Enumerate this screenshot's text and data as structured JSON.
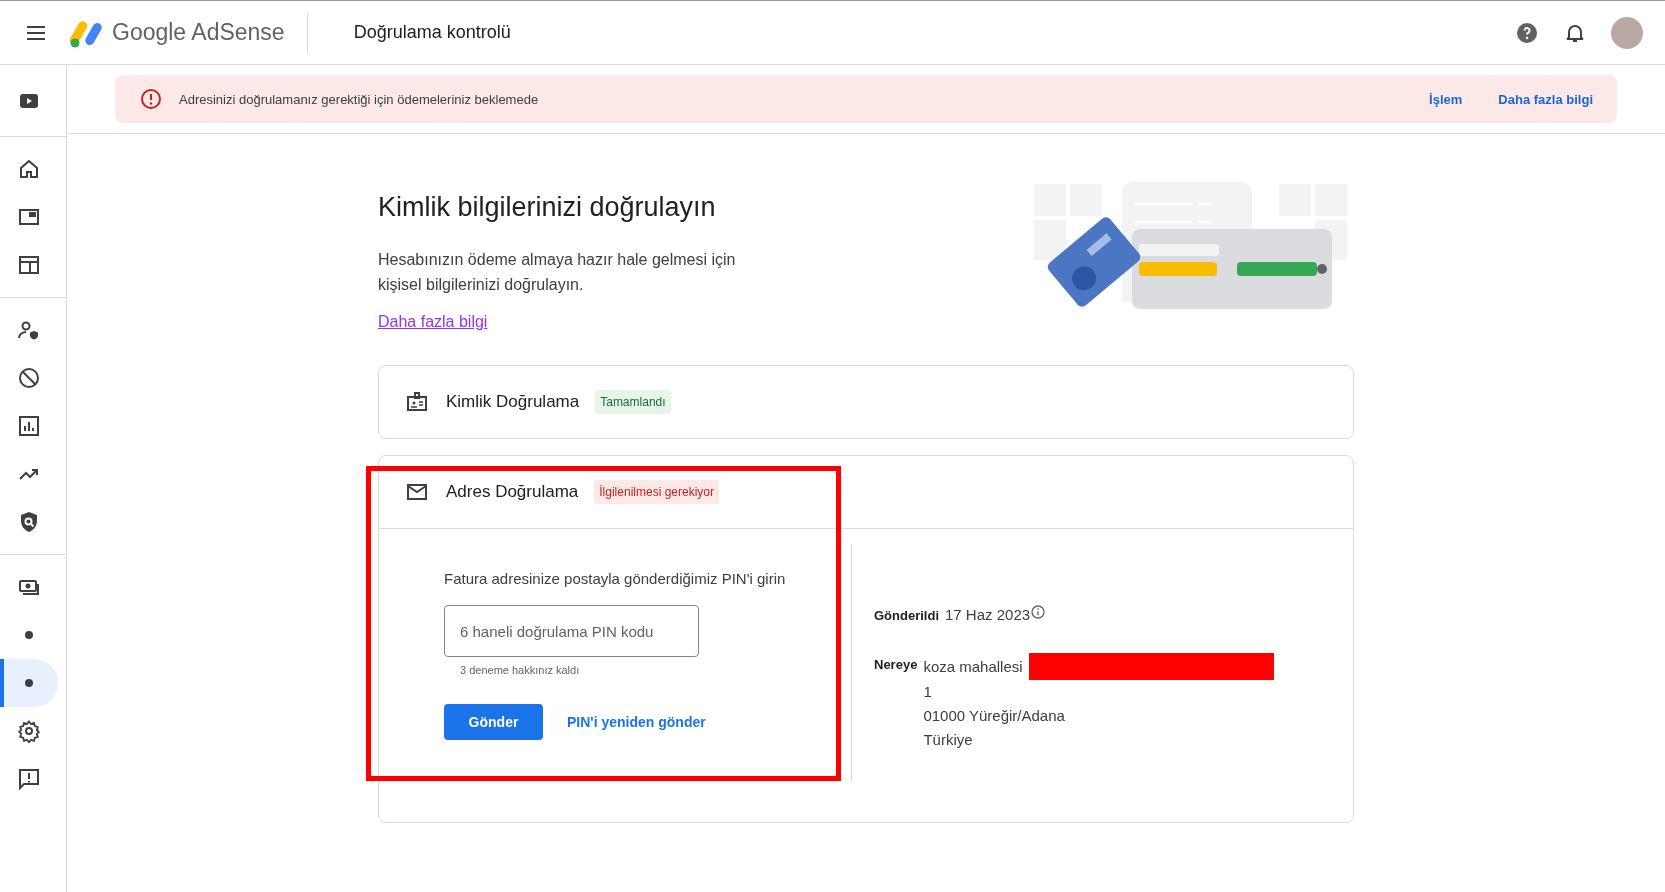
{
  "header": {
    "product": "Google AdSense",
    "page_title": "Doğrulama kontrolü"
  },
  "sidebar": {
    "groups": [
      [
        {
          "selected": false
        }
      ],
      [
        {
          "selected": false
        },
        {
          "selected": false
        },
        {
          "selected": false
        }
      ],
      [
        {
          "selected": false
        },
        {
          "selected": false
        },
        {
          "selected": false
        },
        {
          "selected": false
        },
        {
          "selected": false
        }
      ],
      [
        {
          "selected": false
        },
        {
          "selected": false
        },
        {
          "selected": true
        },
        {
          "selected": false
        },
        {
          "selected": false
        }
      ]
    ]
  },
  "banner": {
    "message": "Adresinizi doğrulamanız gerektiği için ödemeleriniz beklemede",
    "actions": [
      "İşlem",
      "Daha fazla bilgi"
    ]
  },
  "intro": {
    "title": "Kimlik bilgilerinizi doğrulayın",
    "description": "Hesabınızın ödeme almaya hazır hale gelmesi için kişisel bilgilerinizi doğrulayın.",
    "link": "Daha fazla bilgi"
  },
  "steps": [
    {
      "kind": "identity",
      "title": "Kimlik Doğrulama",
      "complete": true,
      "status_label": "Tamamlandı",
      "expanded": false
    },
    {
      "kind": "address",
      "title": "Adres Doğrulama",
      "complete": false,
      "status_label": "İlgilenilmesi gerekiyor",
      "expanded": true,
      "instruction": "Fatura adresinize postayla gönderdiğimiz PIN'i girin",
      "pin_field": {
        "placeholder": "6 haneli doğrulama PIN kodu"
      },
      "attempts_note": "3 deneme hakkınız kaldı",
      "submit": "Gönder",
      "resend": "PIN'i yeniden gönder",
      "sent_label": "Gönderildi",
      "sent_date": "17 Haz 2023",
      "to_label": "Nereye",
      "address_lines": [
        "koza mahallesi",
        "1",
        "01000 Yüreğir/Adana",
        "Türkiye"
      ],
      "redacted": true
    }
  ],
  "annotation": {
    "highlighted": true
  }
}
